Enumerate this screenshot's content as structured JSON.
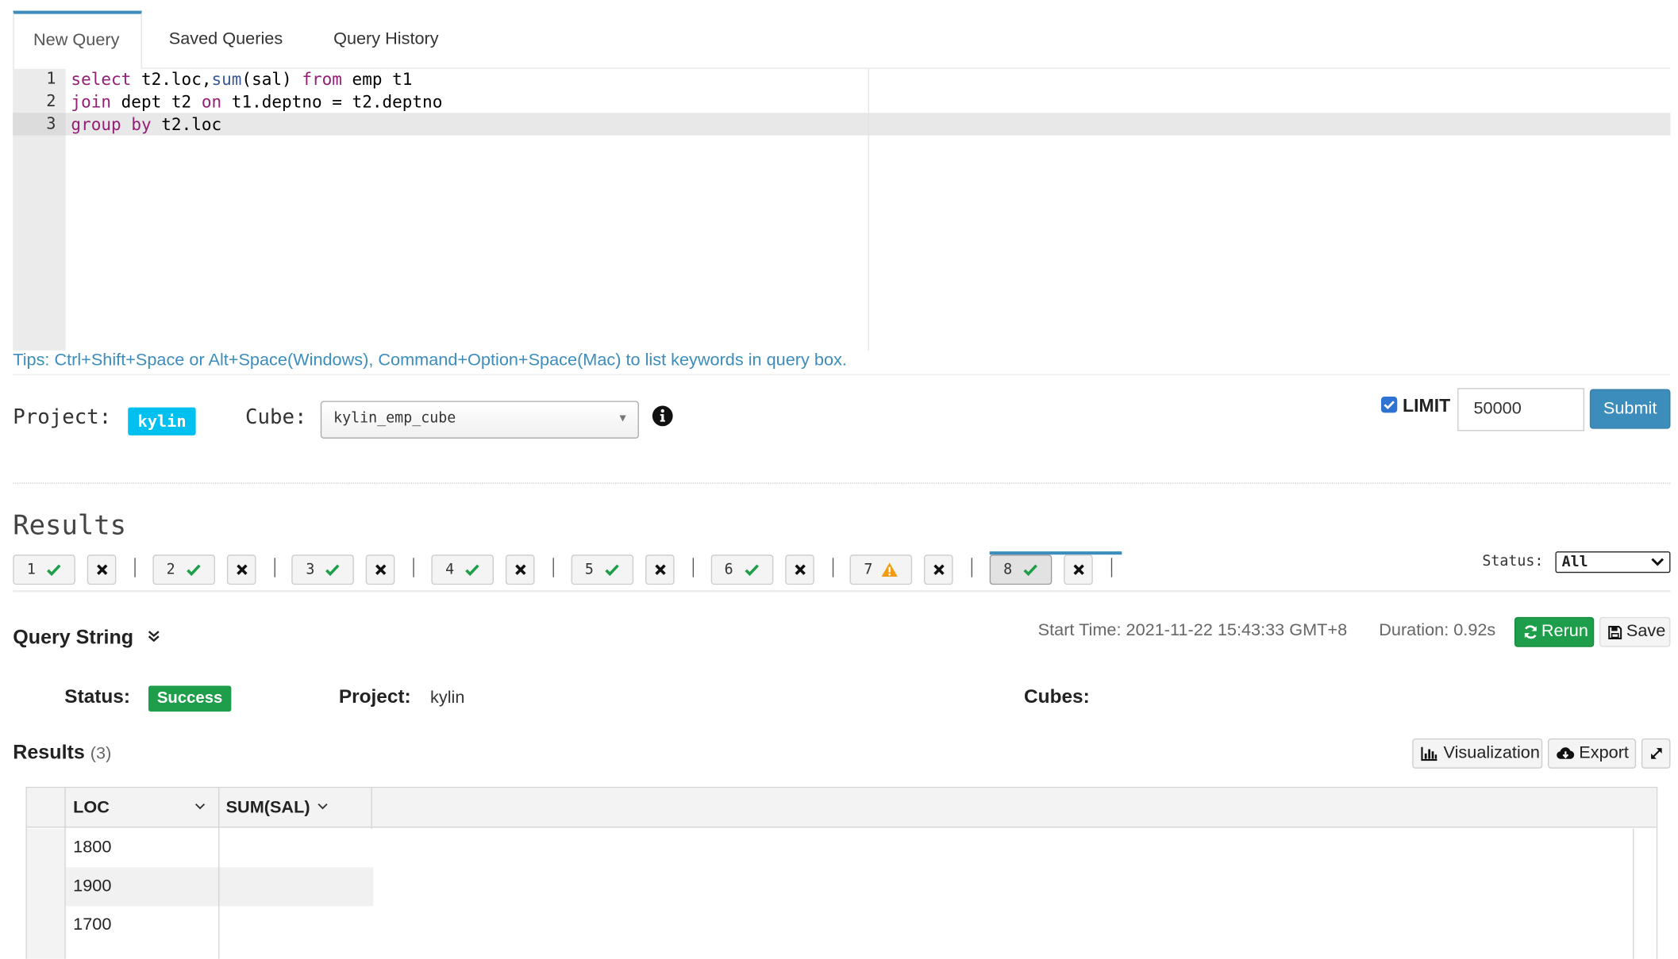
{
  "tabs": [
    "New Query",
    "Saved Queries",
    "Query History"
  ],
  "editor": {
    "line_numbers": [
      "1",
      "2",
      "3"
    ],
    "lines": [
      [
        {
          "t": "select",
          "c": "kw"
        },
        {
          "t": " t2.loc,",
          "c": ""
        },
        {
          "t": "sum",
          "c": "fn"
        },
        {
          "t": "(sal) ",
          "c": ""
        },
        {
          "t": "from",
          "c": "kw"
        },
        {
          "t": " emp t1",
          "c": ""
        }
      ],
      [
        {
          "t": "join",
          "c": "kw"
        },
        {
          "t": " dept t2 ",
          "c": ""
        },
        {
          "t": "on",
          "c": "kw"
        },
        {
          "t": " t1.deptno = t2.deptno",
          "c": ""
        }
      ],
      [
        {
          "t": "group",
          "c": "kw"
        },
        {
          "t": " ",
          "c": ""
        },
        {
          "t": "by",
          "c": "kw"
        },
        {
          "t": " t2.loc",
          "c": ""
        }
      ]
    ]
  },
  "tips": "Tips: Ctrl+Shift+Space or Alt+Space(Windows), Command+Option+Space(Mac) to list keywords in query box.",
  "project": {
    "label": "Project:",
    "value": "kylin"
  },
  "cube": {
    "label": "Cube:",
    "value": "kylin_emp_cube"
  },
  "limit": {
    "label": "LIMIT",
    "checked": true,
    "value": "50000"
  },
  "submit_label": "Submit",
  "results_title": "Results",
  "query_tabs": [
    {
      "num": "1",
      "status": "success"
    },
    {
      "num": "2",
      "status": "success"
    },
    {
      "num": "3",
      "status": "success"
    },
    {
      "num": "4",
      "status": "success"
    },
    {
      "num": "5",
      "status": "success"
    },
    {
      "num": "6",
      "status": "success"
    },
    {
      "num": "7",
      "status": "warning"
    },
    {
      "num": "8",
      "status": "success",
      "active": true
    }
  ],
  "status_filter": {
    "label": "Status:",
    "value": "All"
  },
  "query_string_label": "Query String",
  "start_time": "Start Time: 2021-11-22 15:43:33 GMT+8",
  "duration": "Duration: 0.92s",
  "rerun_label": "Rerun",
  "save_label": "Save",
  "info": {
    "status_label": "Status:",
    "status_value": "Success",
    "project_label": "Project:",
    "project_value": "kylin",
    "cubes_label": "Cubes:"
  },
  "result_table": {
    "title": "Results",
    "count": "(3)",
    "visualization_label": "Visualization",
    "export_label": "Export",
    "columns": [
      "LOC",
      "SUM(SAL)"
    ],
    "rows": [
      [
        "1800",
        ""
      ],
      [
        "1900",
        ""
      ],
      [
        "1700",
        ""
      ]
    ]
  },
  "colors": {
    "primary": "#3c8dbc",
    "success": "#1e9e4a",
    "info_badge": "#00c0ef",
    "warning": "#f39c12",
    "keyword": "#931e75"
  }
}
